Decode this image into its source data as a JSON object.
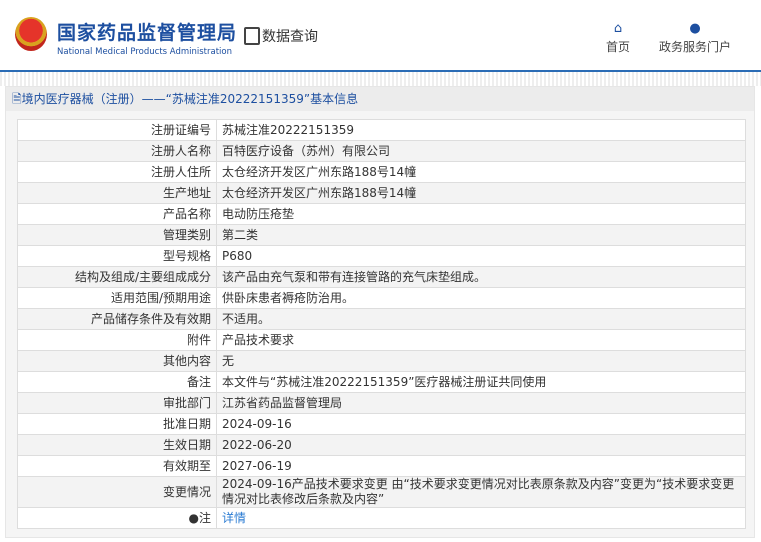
{
  "header": {
    "site_name_cn": "国家药品监督管理局",
    "site_name_en": "National Medical Products Administration",
    "query_label": "数据查询",
    "nav": [
      {
        "label": "首页",
        "icon": "home-icon"
      },
      {
        "label": "政务服务门户",
        "icon": "user-icon"
      }
    ]
  },
  "page_title": "境内医疗器械（注册）——“苏械注准20222151359”基本信息",
  "rows": [
    {
      "label": "注册证编号",
      "value": "苏械注准20222151359"
    },
    {
      "label": "注册人名称",
      "value": "百特医疗设备（苏州）有限公司"
    },
    {
      "label": "注册人住所",
      "value": "太仓经济开发区广州东路188号14幢"
    },
    {
      "label": "生产地址",
      "value": "太仓经济开发区广州东路188号14幢"
    },
    {
      "label": "产品名称",
      "value": "电动防压疮垫"
    },
    {
      "label": "管理类别",
      "value": "第二类"
    },
    {
      "label": "型号规格",
      "value": "P680"
    },
    {
      "label": "结构及组成/主要组成成分",
      "value": "该产品由充气泵和带有连接管路的充气床垫组成。"
    },
    {
      "label": "适用范围/预期用途",
      "value": "供卧床患者褥疮防治用。"
    },
    {
      "label": "产品储存条件及有效期",
      "value": "不适用。"
    },
    {
      "label": "附件",
      "value": "产品技术要求"
    },
    {
      "label": "其他内容",
      "value": "无"
    },
    {
      "label": "备注",
      "value": "本文件与“苏械注准20222151359”医疗器械注册证共同使用"
    },
    {
      "label": "审批部门",
      "value": "江苏省药品监督管理局"
    },
    {
      "label": "批准日期",
      "value": "2024-09-16"
    },
    {
      "label": "生效日期",
      "value": "2022-06-20"
    },
    {
      "label": "有效期至",
      "value": "2027-06-19"
    },
    {
      "label": "变更情况",
      "value": "2024-09-16产品技术要求变更 由“技术要求变更情况对比表原条款及内容”变更为“技术要求变更情况对比表修改后条款及内容”"
    }
  ],
  "note": {
    "label": "注",
    "link": "详情"
  }
}
